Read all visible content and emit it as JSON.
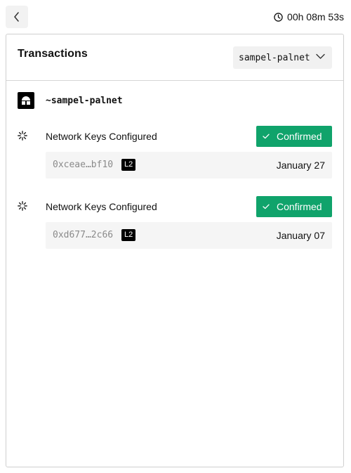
{
  "header": {
    "back_icon": "chevron-left-icon",
    "timer_icon": "clock-icon",
    "timer": "00h 08m 53s"
  },
  "panel": {
    "title": "Transactions",
    "select": {
      "value": "sampel-palnet",
      "icon": "chevron-down-icon"
    }
  },
  "identity": {
    "name": "~sampel-palnet",
    "icon": "sigil-icon"
  },
  "transactions": [
    {
      "label": "Network Keys Configured",
      "status": "Confirmed",
      "hash": "0xceae…bf10",
      "layer": "L2",
      "date": "January 27"
    },
    {
      "label": "Network Keys Configured",
      "status": "Confirmed",
      "hash": "0xd677…2c66",
      "layer": "L2",
      "date": "January 07"
    }
  ],
  "colors": {
    "confirmed": "#10a36b",
    "badge": "#000000",
    "detail_bg": "#f5f5f5",
    "hash_text": "#8a8a8a"
  }
}
